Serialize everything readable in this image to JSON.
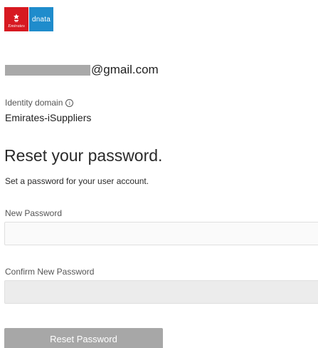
{
  "brand": {
    "emirates_text": "Emirates",
    "dnata_text": "dnata",
    "emirates_color": "#d71921",
    "dnata_color": "#1f8ccc"
  },
  "account": {
    "email_domain": "@gmail.com"
  },
  "identity": {
    "label": "Identity domain",
    "info_icon": "i",
    "value": "Emirates-iSuppliers"
  },
  "form": {
    "title": "Reset your password.",
    "subtitle": "Set a password for your user account.",
    "new_password_label": "New Password",
    "new_password_value": "",
    "confirm_password_label": "Confirm New Password",
    "confirm_password_value": "",
    "submit_label": "Reset Password"
  }
}
